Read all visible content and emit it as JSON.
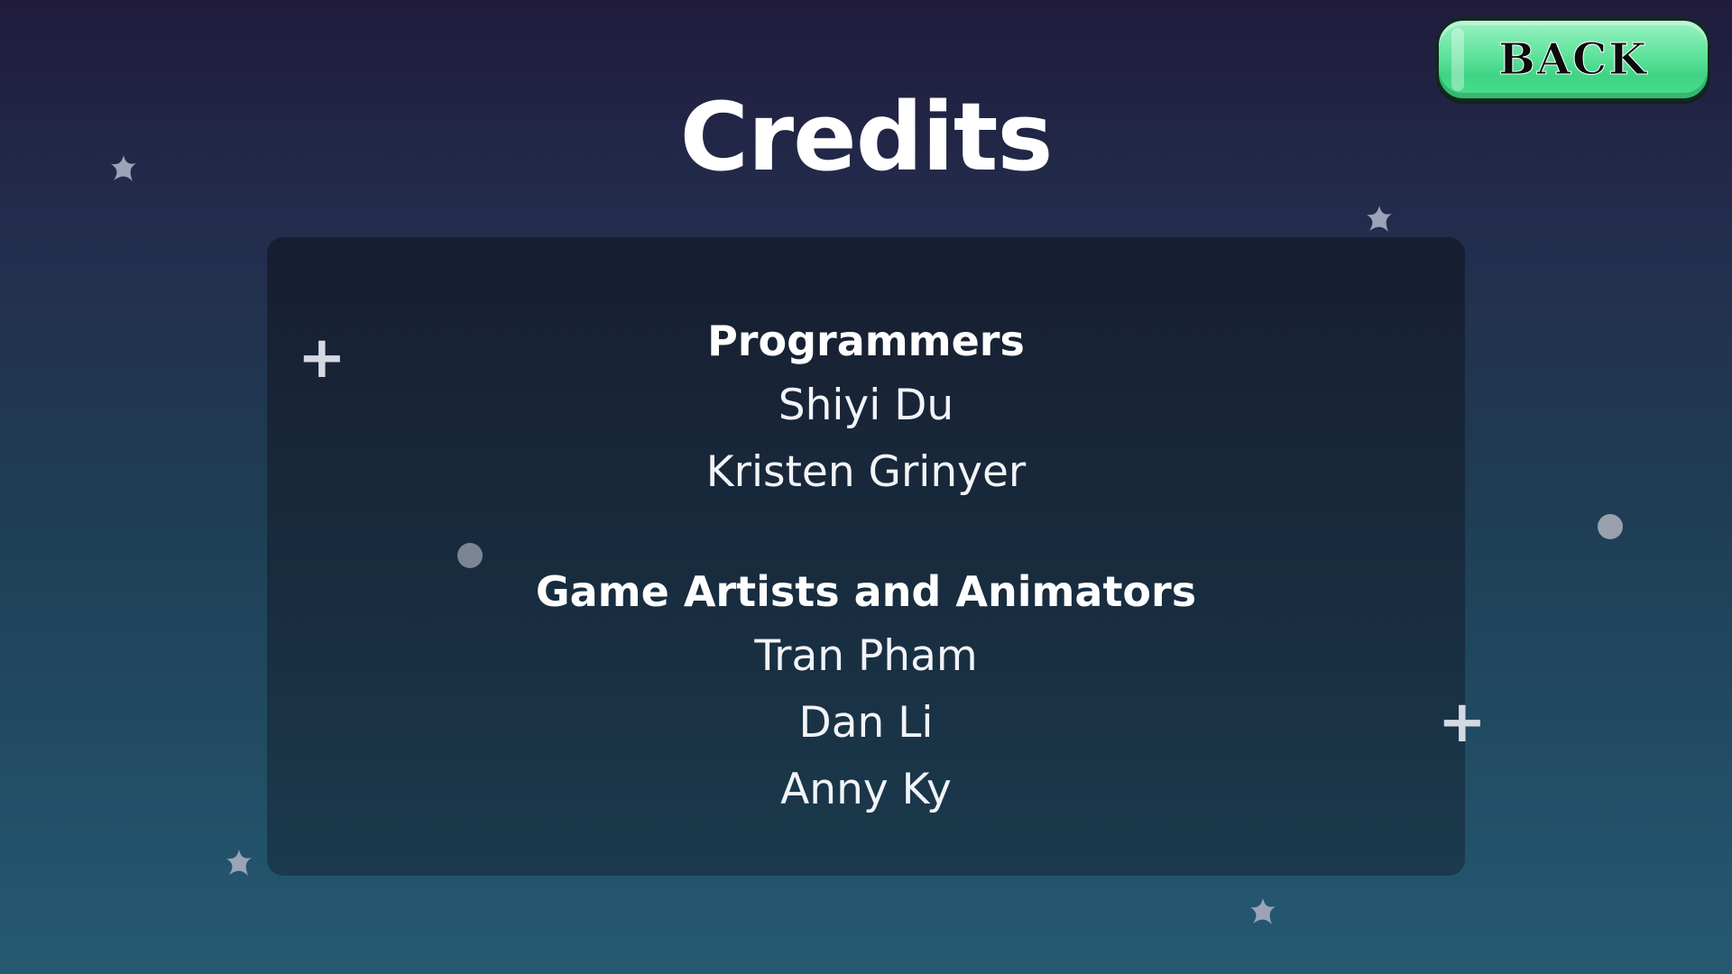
{
  "screen": {
    "title": "Credits",
    "back_button_label": "BACK"
  },
  "credits": {
    "programmers": {
      "heading": "Programmers",
      "names": [
        "Shiyi Du",
        "Kristen Grinyer"
      ]
    },
    "artists": {
      "heading": "Game Artists and Animators",
      "names": [
        "Tran Pham",
        "Dan Li",
        "Anny Ky"
      ]
    }
  },
  "decorations": {
    "icons": [
      "sparkle-icon",
      "plus-icon",
      "dot-icon"
    ]
  },
  "colors": {
    "background_top": "#201b3c",
    "background_bottom": "#245a72",
    "button_green": "#5fe39c",
    "text": "#ffffff"
  }
}
